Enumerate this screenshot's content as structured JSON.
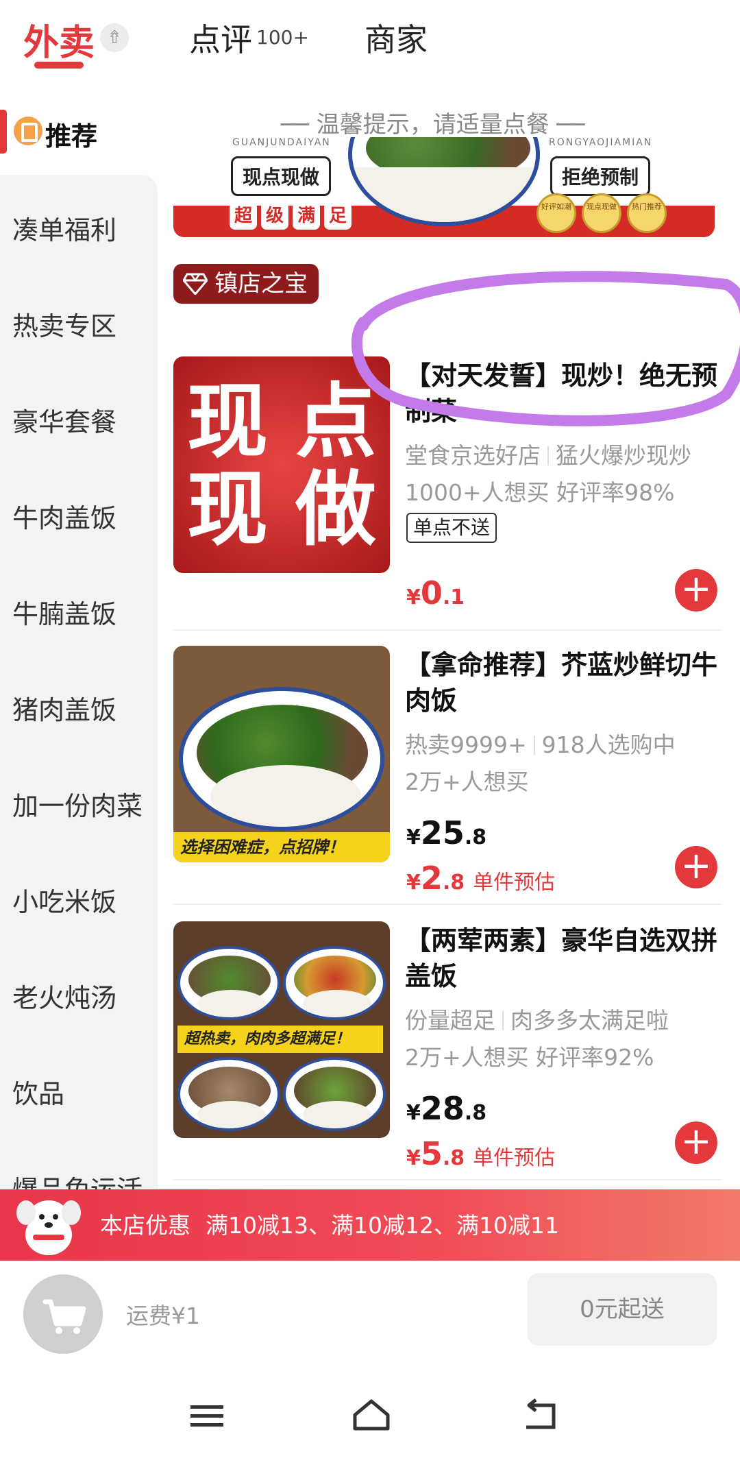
{
  "tabs": {
    "takeout": "外卖",
    "collapse_glyph": "⇮",
    "review": "点评",
    "review_badge": "100+",
    "merchant": "商家"
  },
  "sidebar": {
    "active": "推荐",
    "items": [
      "凑单福利",
      "热卖专区",
      "豪华套餐",
      "牛肉盖饭",
      "牛腩盖饭",
      "猪肉盖饭",
      "加一份肉菜",
      "小吃米饭",
      "老火炖汤",
      "饮品",
      "爆品免运活"
    ]
  },
  "tip": "── 温馨提示，请适量点餐 ──",
  "banner": {
    "brand_left": "GUANJUNDAIYAN",
    "brand_right": "RONGYAOJIAMIAN",
    "label_left": "现点现做",
    "label_right": "拒绝预制",
    "chips": [
      "超",
      "级",
      "满",
      "足"
    ],
    "seals": [
      "好评如潮",
      "现点现做",
      "热门推荐"
    ]
  },
  "section_badge": "镇店之宝",
  "products": [
    {
      "title": "【对天发誓】现炒！绝无预制菜",
      "meta1": [
        "堂食京选好店",
        "猛火爆炒现炒"
      ],
      "meta2": "1000+人想买 好评率98%",
      "tag": "单点不送",
      "price_symbol": "¥",
      "price_int": "0",
      "price_dec": ".1",
      "image_text": [
        "现",
        "点",
        "现",
        "做"
      ]
    },
    {
      "title": "【拿命推荐】芥蓝炒鲜切牛肉饭",
      "meta1": [
        "热卖9999+",
        "918人选购中"
      ],
      "meta2": "2万+人想买",
      "price_symbol": "¥",
      "price_int": "25",
      "price_dec": ".8",
      "est_symbol": "¥",
      "est_int": "2",
      "est_dec": ".8",
      "est_note": "单件预估",
      "image_caption": "选择困难症，点招牌！"
    },
    {
      "title": "【两荤两素】豪华自选双拼盖饭",
      "meta1": [
        "份量超足",
        "肉多多太满足啦"
      ],
      "meta2": "2万+人想买 好评率92%",
      "price_symbol": "¥",
      "price_int": "28",
      "price_dec": ".8",
      "est_symbol": "¥",
      "est_int": "5",
      "est_dec": ".8",
      "est_note": "单件预估",
      "image_caption": "超热卖，肉肉多超满足！"
    }
  ],
  "add_glyph": "+",
  "promo": {
    "title": "本店优惠",
    "text": "满10减13、满10减12、满10减11"
  },
  "cart": {
    "shipping": "运费¥1",
    "min_order": "0元起送"
  },
  "colors": {
    "accent": "#e4393c",
    "sidebar_bg": "#f2f3f5",
    "annotation": "#c27be8"
  }
}
